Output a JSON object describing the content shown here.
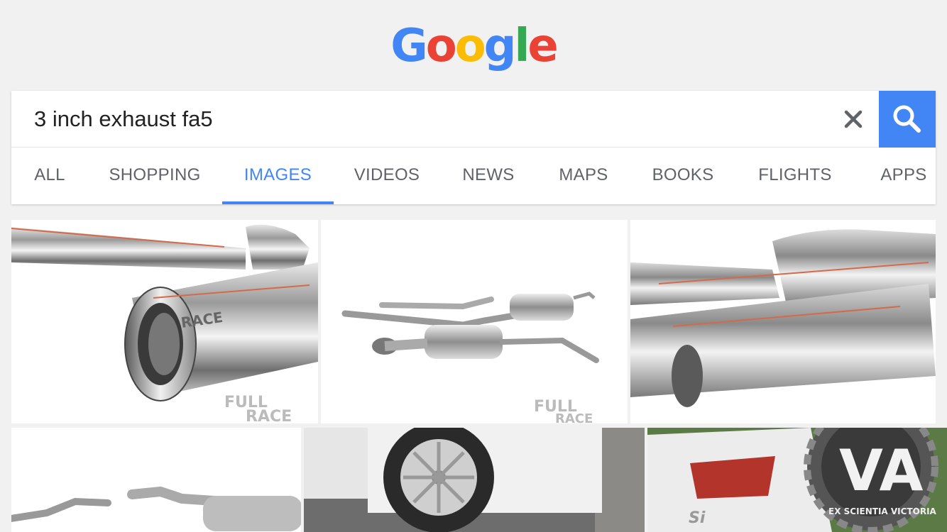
{
  "logo": {
    "letters": [
      "G",
      "o",
      "o",
      "g",
      "l",
      "e"
    ]
  },
  "search": {
    "query": "3 inch exhaust fa5"
  },
  "icons": {
    "clear": "close-icon",
    "search": "search-icon"
  },
  "tabs": [
    {
      "label": "ALL"
    },
    {
      "label": "SHOPPING"
    },
    {
      "label": "IMAGES",
      "active": true
    },
    {
      "label": "VIDEOS"
    },
    {
      "label": "NEWS"
    },
    {
      "label": "MAPS"
    },
    {
      "label": "BOOKS"
    },
    {
      "label": "FLIGHTS"
    },
    {
      "label": "APPS"
    }
  ],
  "images": {
    "watermark_full": "FULL",
    "watermark_race": "RACE",
    "closeup_engraving": "RACE",
    "trim_badge": "Si",
    "va_logo_letters": "VA",
    "va_logo_motto": "EX SCIENTIA VICTORIA"
  },
  "colors": {
    "accent": "#4285f4",
    "blue": "#4285f4",
    "red": "#ea4335",
    "yellow": "#fbbc05",
    "green": "#34a853"
  }
}
